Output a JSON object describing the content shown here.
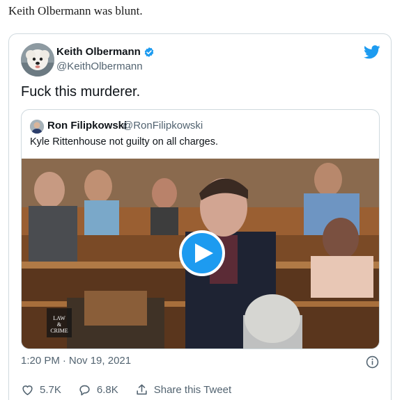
{
  "intro": {
    "text": "Keith Olbermann was blunt."
  },
  "tweet": {
    "author_name": "Keith Olbermann",
    "author_handle": "@KeithOlbermann",
    "text": "Fuck this murderer.",
    "time": "1:20 PM",
    "separator": "·",
    "date": "Nov 19, 2021",
    "likes": "5.7K",
    "replies": "6.8K",
    "share_label": "Share this Tweet"
  },
  "quoted_tweet": {
    "author_name": "Ron Filipkowski",
    "author_handle": "@RonFilipkowski",
    "text": "Kyle Rittenhouse not guilty on all charges."
  },
  "video": {
    "watermark_lines": [
      "LAW",
      "&",
      "CRIME"
    ]
  },
  "colors": {
    "accent": "#1d9bf0",
    "muted": "#536471",
    "border": "#cfd9de",
    "text": "#0f1419"
  },
  "icons": [
    "verified-badge-icon",
    "twitter-bird-icon",
    "play-icon",
    "info-icon",
    "heart-icon",
    "reply-icon",
    "share-icon"
  ]
}
